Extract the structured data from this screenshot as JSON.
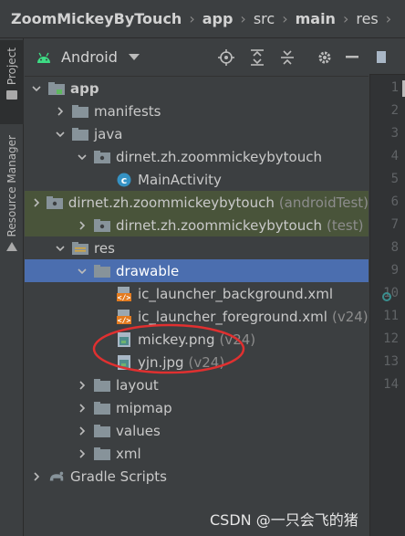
{
  "breadcrumb": [
    "ZoomMickeyByTouch",
    "app",
    "src",
    "main",
    "res",
    "drawa"
  ],
  "side_tabs": {
    "project": "Project",
    "resource_manager": "Resource Manager"
  },
  "project_header": {
    "view": "Android"
  },
  "tree": [
    {
      "label": "app",
      "suffix": "",
      "icon": "module-folder-icon",
      "arrow": "down",
      "bold": true
    },
    {
      "label": "manifests",
      "suffix": "",
      "icon": "folder-icon",
      "arrow": "right"
    },
    {
      "label": "java",
      "suffix": "",
      "icon": "folder-icon",
      "arrow": "down"
    },
    {
      "label": "dirnet.zh.zoommickeybytouch",
      "suffix": "",
      "icon": "package-icon",
      "arrow": "down"
    },
    {
      "label": "MainActivity",
      "suffix": "",
      "icon": "class-icon",
      "arrow": "none"
    },
    {
      "label": "dirnet.zh.zoommickeybytouch",
      "suffix": "(androidTest)",
      "icon": "package-icon",
      "arrow": "right"
    },
    {
      "label": "dirnet.zh.zoommickeybytouch",
      "suffix": "(test)",
      "icon": "package-icon",
      "arrow": "right"
    },
    {
      "label": "res",
      "suffix": "",
      "icon": "res-folder-icon",
      "arrow": "down"
    },
    {
      "label": "drawable",
      "suffix": "",
      "icon": "folder-icon",
      "arrow": "down"
    },
    {
      "label": "ic_launcher_background.xml",
      "suffix": "",
      "icon": "xml-file-icon",
      "arrow": "none"
    },
    {
      "label": "ic_launcher_foreground.xml",
      "suffix": "(v24)",
      "icon": "xml-file-icon",
      "arrow": "none"
    },
    {
      "label": "mickey.png",
      "suffix": "(v24)",
      "icon": "image-file-icon",
      "arrow": "none"
    },
    {
      "label": "yjn.jpg",
      "suffix": "(v24)",
      "icon": "image-file-icon",
      "arrow": "none"
    },
    {
      "label": "layout",
      "suffix": "",
      "icon": "folder-icon",
      "arrow": "right"
    },
    {
      "label": "mipmap",
      "suffix": "",
      "icon": "folder-icon",
      "arrow": "right"
    },
    {
      "label": "values",
      "suffix": "",
      "icon": "folder-icon",
      "arrow": "right"
    },
    {
      "label": "xml",
      "suffix": "",
      "icon": "folder-icon",
      "arrow": "right"
    },
    {
      "label": "Gradle Scripts",
      "suffix": "",
      "icon": "gradle-icon",
      "arrow": "right"
    }
  ],
  "line_numbers": [
    "1",
    "2",
    "3",
    "4",
    "5",
    "6",
    "7",
    "8",
    "9",
    "10",
    "11",
    "12",
    "13",
    "14"
  ],
  "watermark": "CSDN @一只会飞的猪"
}
